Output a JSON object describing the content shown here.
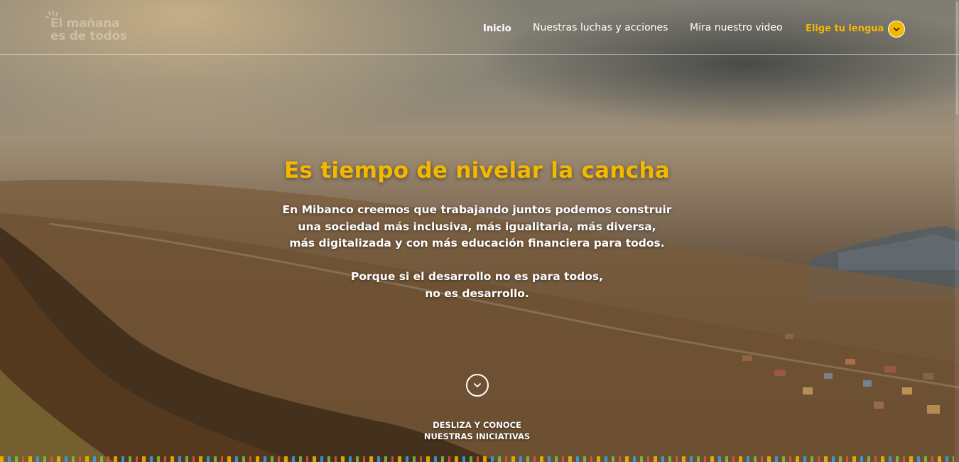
{
  "header": {
    "logo_line1": "El mañana",
    "logo_line2": "es de todos",
    "nav": {
      "inicio": "Inicio",
      "luchas": "Nuestras luchas y acciones",
      "video": "Mira nuestro video",
      "lang": "Elige tu lengua"
    }
  },
  "hero": {
    "title": "Es tiempo de nivelar la cancha",
    "paragraph1": [
      "En Mibanco creemos que trabajando juntos podemos construir",
      "una sociedad más inclusiva, más igualitaria, más diversa,",
      "más digitalizada y con más educación financiera para todos."
    ],
    "paragraph2": [
      "Porque si el desarrollo no es para todos,",
      "no es desarrollo."
    ]
  },
  "scroll": {
    "caption_line1": "DESLIZA Y CONOCE",
    "caption_line2": "NUESTRAS INICIATIVAS"
  },
  "colors": {
    "accent": "#f4b800",
    "text": "#ffffff"
  },
  "icons": {
    "logo": "sun-rays-icon",
    "lang_toggle": "chevron-down-icon",
    "scroll_down": "chevron-down-icon"
  }
}
